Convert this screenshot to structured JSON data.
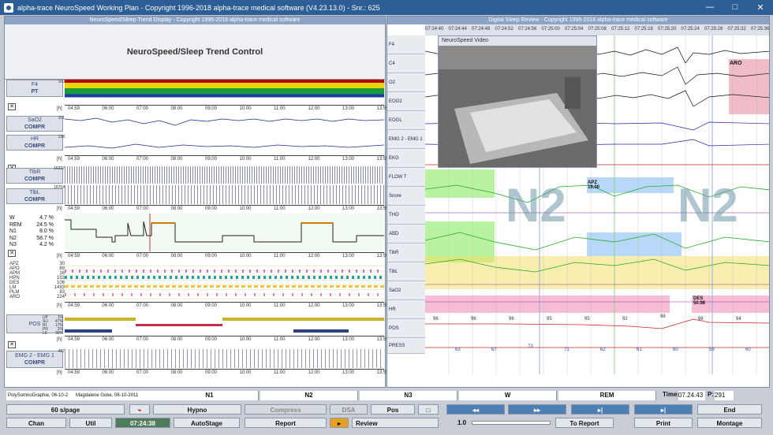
{
  "window": {
    "title": "alpha-trace NeuroSpeed Working Plan - Copyright 1996-2018 alpha-trace medical software (V4.23.13.0) - Snr.: 625"
  },
  "left": {
    "header": "NeuroSpeed/Sleep Trend Display - Copyright 1996-2018 alpha-trace medical software",
    "title": "NeuroSpeed/Sleep Trend Control",
    "ticks": [
      "04:59",
      "06:00",
      "07:00",
      "08:00",
      "09:00",
      "10:00",
      "11:00",
      "12:00",
      "13:00",
      "13:59"
    ],
    "unit_h": "[h]",
    "channels": [
      {
        "name": "F4",
        "sub": "PT",
        "ymax": "100",
        "ymin": "0",
        "unit": "[%]"
      },
      {
        "name": "SaO2",
        "sub": "COMPR",
        "ymax": "101",
        "ymin": "79",
        "unit": "[%]"
      },
      {
        "name": "HR",
        "sub": "COMPR",
        "ymax": "138",
        "ymin": "20",
        "unit": "[bpm]"
      },
      {
        "name": "TibR",
        "sub": "COMPR",
        "ymax": "16237",
        "ymin": "0",
        "unit": "[µV]"
      },
      {
        "name": "TibL",
        "sub": "COMPR",
        "ymax": "18704",
        "ymin": "0",
        "unit": "[µV]"
      },
      {
        "name": "POS",
        "sub": "",
        "ymax": "",
        "ymin": "",
        "unit": ""
      },
      {
        "name": "EMG 2 - EMG 1",
        "sub": "COMPR",
        "ymax": "487",
        "ymin": "0",
        "unit": "[µV]"
      }
    ],
    "stages": [
      {
        "k": "W",
        "v": "4.7 %"
      },
      {
        "k": "REM",
        "v": "24.5 %"
      },
      {
        "k": "N1",
        "v": "8.0 %"
      },
      {
        "k": "N2",
        "v": "58.7 %"
      },
      {
        "k": "N3",
        "v": "4.2 %"
      }
    ],
    "events": [
      {
        "k": "APZ",
        "v": "30"
      },
      {
        "k": "APO",
        "v": "69"
      },
      {
        "k": "APM",
        "v": "16"
      },
      {
        "k": "HPN",
        "v": "153"
      },
      {
        "k": "DES",
        "v": "106"
      },
      {
        "k": "LM",
        "v": "1493"
      },
      {
        "k": "PLM",
        "v": "83"
      },
      {
        "k": "ARO",
        "v": "224"
      }
    ],
    "pos": [
      {
        "k": "UP",
        "v": "1%"
      },
      {
        "k": "SU",
        "v": "47%"
      },
      {
        "k": "RI",
        "v": "17%"
      },
      {
        "k": "PR",
        "v": "2%"
      },
      {
        "k": "LE",
        "v": "30%"
      }
    ]
  },
  "right": {
    "header": "Digital Sleep Review - Copyright 1996-2018 alpha-trace medical software",
    "times": [
      "07:24:40",
      "07:24:44",
      "07:24:48",
      "07:24:52",
      "07:24:56",
      "07:25:00",
      "07:25:04",
      "07:25:08",
      "07:25:12",
      "07:25:16",
      "07:25:20",
      "07:25:24",
      "07:25:28",
      "07:25:32",
      "07:25:36"
    ],
    "channels": [
      "F4",
      "C4",
      "O2",
      "EOG2",
      "EOGL",
      "EMG 2 - EMG 1",
      "EKG",
      "FLOW T",
      "Snore",
      "THO",
      "ABD",
      "TibR",
      "TibL",
      "SaO2",
      "HR",
      "POS",
      "PRESS"
    ],
    "video_title": "NeuroSpeed Video",
    "stage_label": "N2",
    "aro": "ARO",
    "apz": "APZ",
    "apz_val": "16.00",
    "des": "DES",
    "des_val": "50.98",
    "sao2_vals": [
      "96",
      "96",
      "96",
      "95",
      "95",
      "92",
      "98",
      "96",
      "94"
    ],
    "hr_vals": [
      "63",
      "67",
      "73",
      "71",
      "62",
      "61",
      "60",
      "59",
      "60"
    ],
    "y_sao2": [
      "100",
      "90"
    ],
    "y_hr": [
      "100",
      "[bpm]",
      "40"
    ],
    "y_pos": [
      "30000",
      "[µV]"
    ],
    "y_press": [
      "[mbar]",
      "0"
    ]
  },
  "footer": {
    "study": "PolySomnoGraphie, 06-10-2",
    "patient": "Magdalene Goke, 06-10-2011",
    "stage_buttons": [
      "N1",
      "N2",
      "N3",
      "W",
      "REM"
    ],
    "time_label": "Time:",
    "time_val": "07.24.43",
    "page_label": "P:",
    "page_val": "291",
    "speed": "60 s/page",
    "hypno": "Hypno",
    "compress": "Compress",
    "dsa": "DSA",
    "pos": "Pos",
    "end": "End",
    "chan": "Chan",
    "util": "Util",
    "clock": "07:24:38",
    "autostage": "AutoStage",
    "report": "Report",
    "review": "Review",
    "zoom": "1.0",
    "to_report": "To Report",
    "print": "Print",
    "montage": "Montage",
    "nav": [
      "◂◂",
      "▸▸",
      "▸|",
      "▸|"
    ]
  }
}
